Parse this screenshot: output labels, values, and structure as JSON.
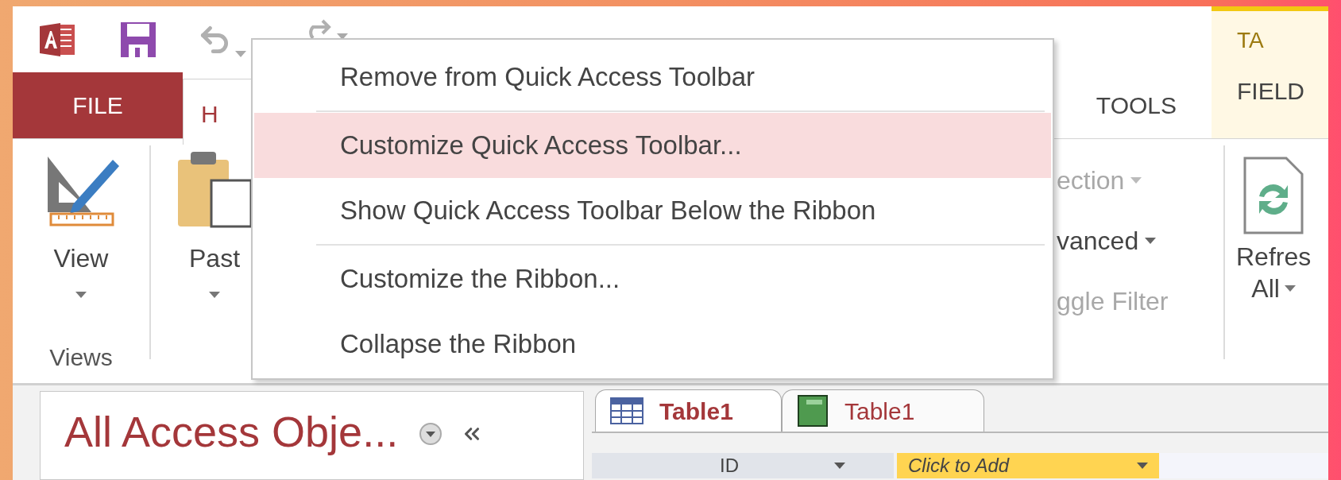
{
  "ribbon_tabs": [
    {
      "label": "FILE",
      "kind": "file",
      "selected": false
    },
    {
      "label": "H",
      "kind": "tab",
      "selected": true
    },
    {
      "label": "TOOLS",
      "kind": "tab",
      "selected": false
    }
  ],
  "contextual_tabs": {
    "header": "TA",
    "tabs": [
      {
        "label": "FIELD",
        "selected": false
      }
    ]
  },
  "ribbon": {
    "view": {
      "label": "View",
      "group": "Views"
    },
    "paste": {
      "label": "Past"
    },
    "sort_filter": [
      {
        "label": "ection",
        "dropdown": true,
        "disabled": true
      },
      {
        "label": "vanced",
        "dropdown": true,
        "disabled": false
      },
      {
        "label": "ggle Filter",
        "dropdown": false,
        "disabled": true
      }
    ],
    "refresh": {
      "lines": [
        "Refres",
        "All"
      ]
    }
  },
  "context_menu": {
    "groups": [
      [
        {
          "label": "Remove from Quick Access Toolbar",
          "selected": false
        }
      ],
      [
        {
          "label": "Customize Quick Access Toolbar...",
          "selected": true
        },
        {
          "label": "Show Quick Access Toolbar Below the Ribbon",
          "selected": false
        }
      ],
      [
        {
          "label": "Customize the Ribbon...",
          "selected": false
        },
        {
          "label": "Collapse the Ribbon",
          "selected": false
        }
      ]
    ]
  },
  "navigation_pane": {
    "title": "All Access Obje..."
  },
  "document_tabs": [
    {
      "label": "Table1",
      "kind": "table",
      "selected": true
    },
    {
      "label": "Table1",
      "kind": "form",
      "selected": false
    }
  ],
  "datasheet": {
    "columns": [
      {
        "label": "ID",
        "kind": "field"
      },
      {
        "label": "Click to Add",
        "kind": "add"
      }
    ]
  }
}
